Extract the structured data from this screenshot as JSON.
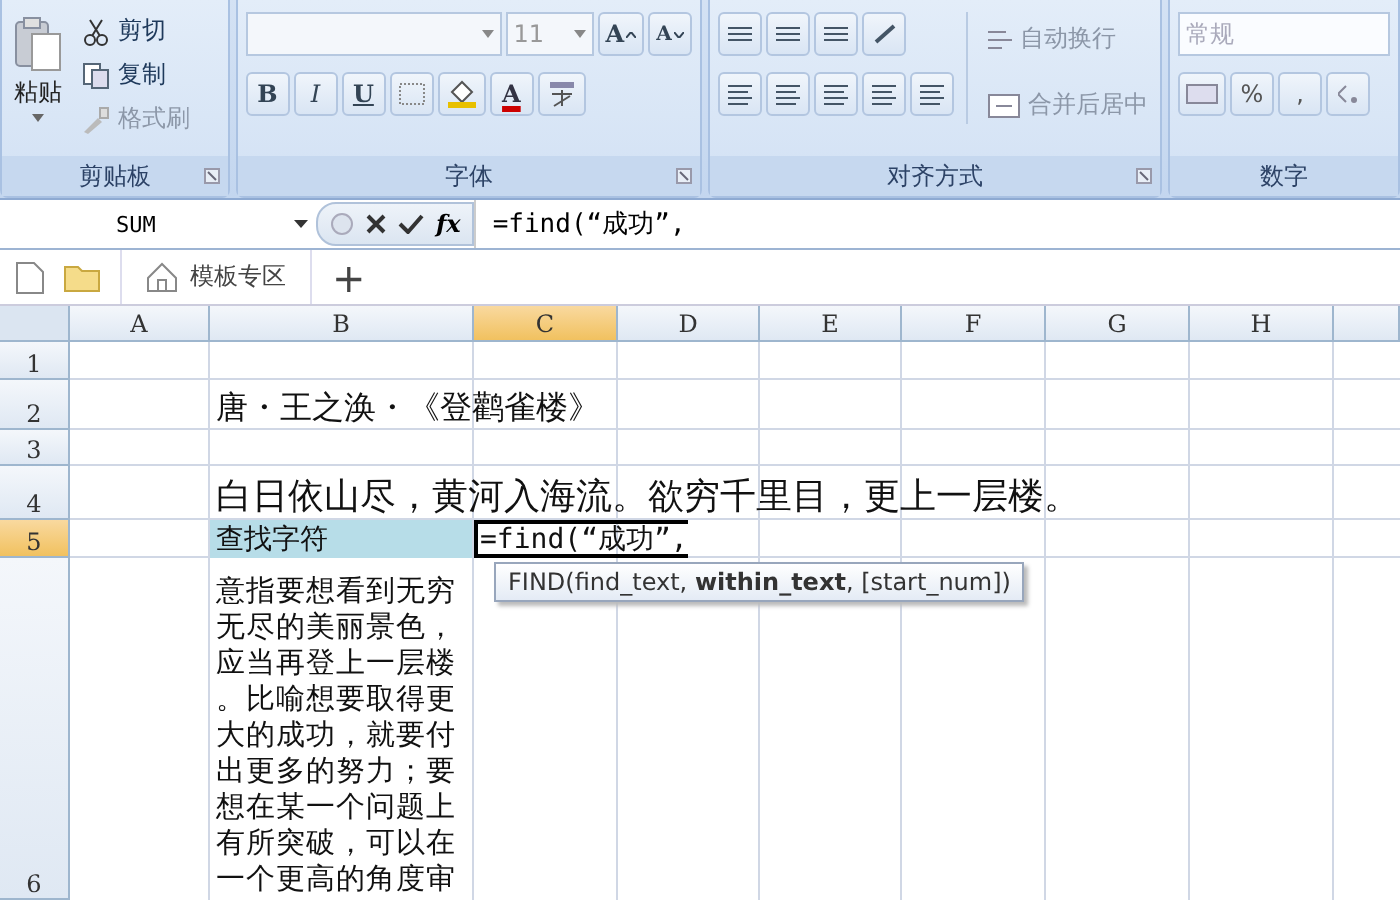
{
  "ribbon": {
    "groups": [
      {
        "kind": "clipboard",
        "title": "剪贴板",
        "paste": "粘贴",
        "buttons": [
          {
            "label": "剪切",
            "disabled": false
          },
          {
            "label": "复制",
            "disabled": false
          },
          {
            "label": "格式刷",
            "disabled": true
          }
        ]
      },
      {
        "kind": "font",
        "title": "字体",
        "font_size": "11",
        "grow": "A",
        "shrink": "A",
        "styles": [
          "B",
          "I",
          "U"
        ],
        "color_letter": "A"
      },
      {
        "kind": "align",
        "title": "对齐方式",
        "wrap": "自动换行",
        "merge": "合并后居中"
      },
      {
        "kind": "number",
        "title": "数字",
        "format": "常规",
        "symbols": [
          "%",
          ","
        ]
      }
    ]
  },
  "formula_bar": {
    "name_box": "SUM",
    "fx": "fx",
    "formula": "=find(“成功”,"
  },
  "tabs": [
    {
      "label": "模板专区"
    }
  ],
  "new_tab": "+",
  "sheet": {
    "columns": [
      {
        "label": "A",
        "selected": false
      },
      {
        "label": "B",
        "selected": false
      },
      {
        "label": "C",
        "selected": true
      },
      {
        "label": "D",
        "selected": false
      },
      {
        "label": "E",
        "selected": false
      },
      {
        "label": "F",
        "selected": false
      },
      {
        "label": "G",
        "selected": false
      },
      {
        "label": "H",
        "selected": false
      }
    ],
    "rows": [
      {
        "label": "1",
        "selected": false,
        "cells": []
      },
      {
        "label": "2",
        "selected": false,
        "cells": [
          {
            "text": ""
          },
          {
            "kind": "title",
            "text": "唐・王之涣・《登鹳雀楼》"
          }
        ]
      },
      {
        "label": "3",
        "selected": false,
        "cells": []
      },
      {
        "label": "4",
        "selected": false,
        "cells": [
          {
            "text": ""
          },
          {
            "kind": "poem",
            "text": "白日依山尽，黄河入海流。欲穷千里目，更上一层楼。"
          }
        ]
      },
      {
        "label": "5",
        "selected": true,
        "cells": [
          {
            "text": ""
          },
          {
            "kind": "label",
            "text": "查找字符"
          },
          {
            "kind": "editing",
            "text": "=find(“成功”,"
          }
        ]
      },
      {
        "label": "6",
        "selected": false,
        "cells": [
          {
            "text": ""
          },
          {
            "kind": "wrap",
            "text": "意指要想看到无穷无尽的美丽景色，应当再登上一层楼。比喻想要取得更大的成功，就要付出更多的努力；要想在某一个问题上有所突破，可以在一个更高的角度审"
          }
        ]
      }
    ],
    "tooltip": "FIND(find_text, **within_text**, [start_num])"
  }
}
